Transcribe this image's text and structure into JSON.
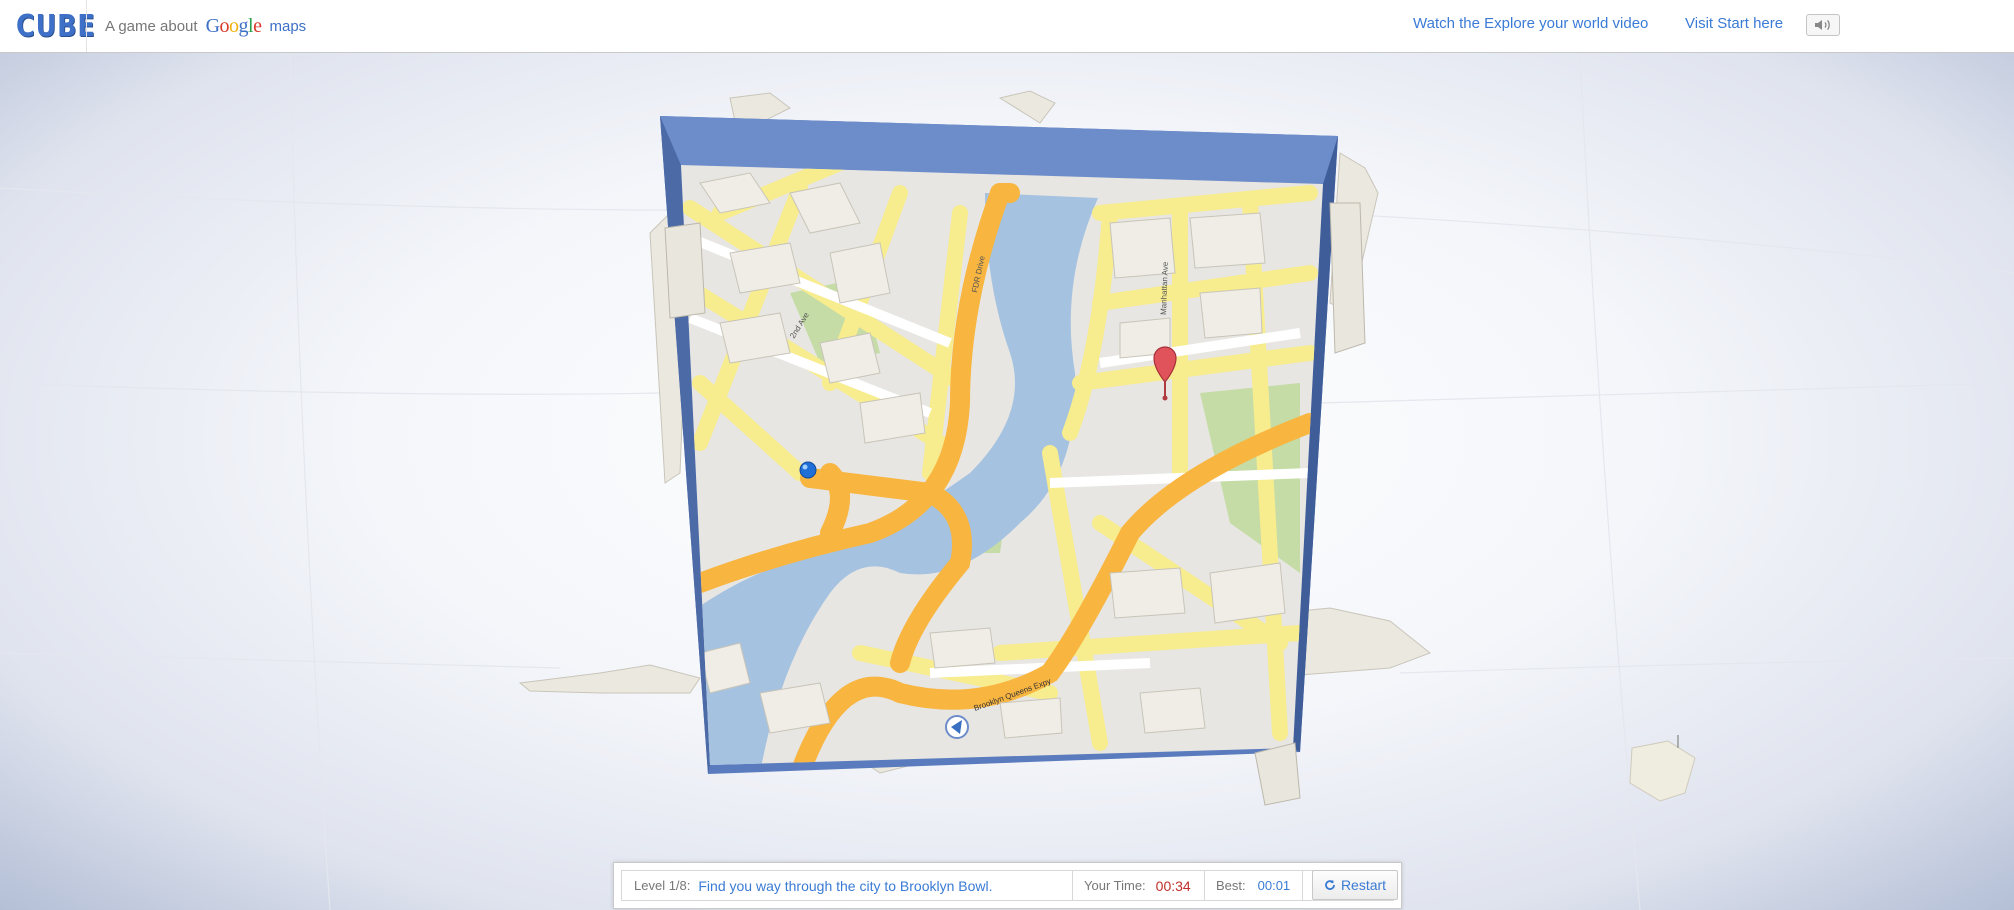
{
  "header": {
    "logo_text": "CUBE",
    "tagline_prefix": "A game about",
    "google_word": "Google",
    "maps_word": "maps",
    "links": [
      {
        "label": "Watch the Explore your world video"
      },
      {
        "label": "Visit Start here"
      }
    ],
    "sound_icon": "speaker-icon"
  },
  "map": {
    "street_labels": [
      "FDR Drive",
      "2nd Ave",
      "Manhattan Ave",
      "Brooklyn Queens Expy"
    ],
    "start_marker_icon": "blue-ball-icon",
    "destination_marker_icon": "red-pin-icon",
    "arrow_icon": "direction-arrow-icon",
    "colors": {
      "frame": "#5a7bbd",
      "water": "#a5c2e0",
      "highway": "#f8b540",
      "street": "#f7ec8e",
      "park": "#c5dca6",
      "ground": "#e7e6e2",
      "building": "#efede6"
    }
  },
  "hud": {
    "level_label": "Level 1/8:",
    "level_message": "Find you way through the city to Brooklyn Bowl.",
    "your_time_label": "Your Time:",
    "your_time_value": "00:34",
    "best_label": "Best:",
    "best_value": "00:01",
    "restart_label": "Restart",
    "restart_icon": "refresh-icon"
  }
}
